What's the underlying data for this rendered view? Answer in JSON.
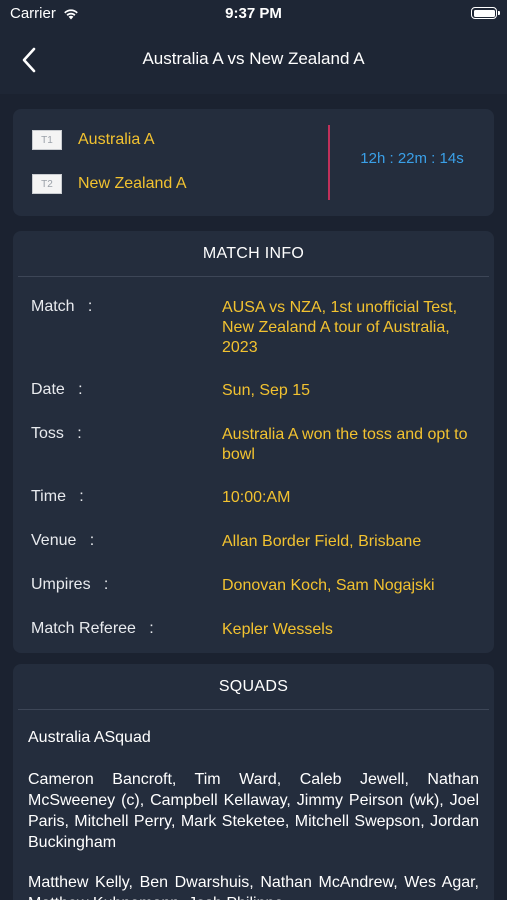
{
  "status_bar": {
    "carrier": "Carrier",
    "time": "9:37 PM"
  },
  "header": {
    "title": "Australia A vs New Zealand A"
  },
  "teams": {
    "team1": {
      "badge": "T1",
      "name": "Australia A"
    },
    "team2": {
      "badge": "T2",
      "name": "New Zealand A"
    },
    "countdown": "12h : 22m : 14s"
  },
  "match_info": {
    "title": "MATCH INFO",
    "rows": [
      {
        "label": "Match   :",
        "value": "AUSA vs NZA, 1st unofficial Test, New Zealand A tour of Australia, 2023"
      },
      {
        "label": "Date   :",
        "value": "Sun, Sep 15"
      },
      {
        "label": "Toss   :",
        "value": "Australia A won the toss and opt to bowl"
      },
      {
        "label": "Time   :",
        "value": "10:00:AM"
      },
      {
        "label": "Venue   :",
        "value": "Allan Border Field, Brisbane"
      },
      {
        "label": "Umpires   :",
        "value": "Donovan Koch, Sam Nogajski"
      },
      {
        "label": "Match Referee   :",
        "value": "Kepler Wessels"
      }
    ]
  },
  "squads": {
    "title": "SQUADS",
    "team_label": "Australia ASquad",
    "players_1": "Cameron Bancroft, Tim Ward, Caleb Jewell, Nathan McSweeney (c), Campbell Kellaway, Jimmy Peirson (wk), Joel Paris, Mitchell Perry, Mark Steketee, Mitchell Swepson, Jordan Buckingham",
    "players_2": "Matthew Kelly, Ben Dwarshuis, Nathan McAndrew, Wes Agar, Matthew Kuhnemann, Josh Philippe"
  },
  "colors": {
    "background": "#1b2230",
    "card": "#242d3d",
    "accent_yellow": "#f2c230",
    "countdown_blue": "#3aa0e8",
    "divider_red": "#c0305a"
  }
}
